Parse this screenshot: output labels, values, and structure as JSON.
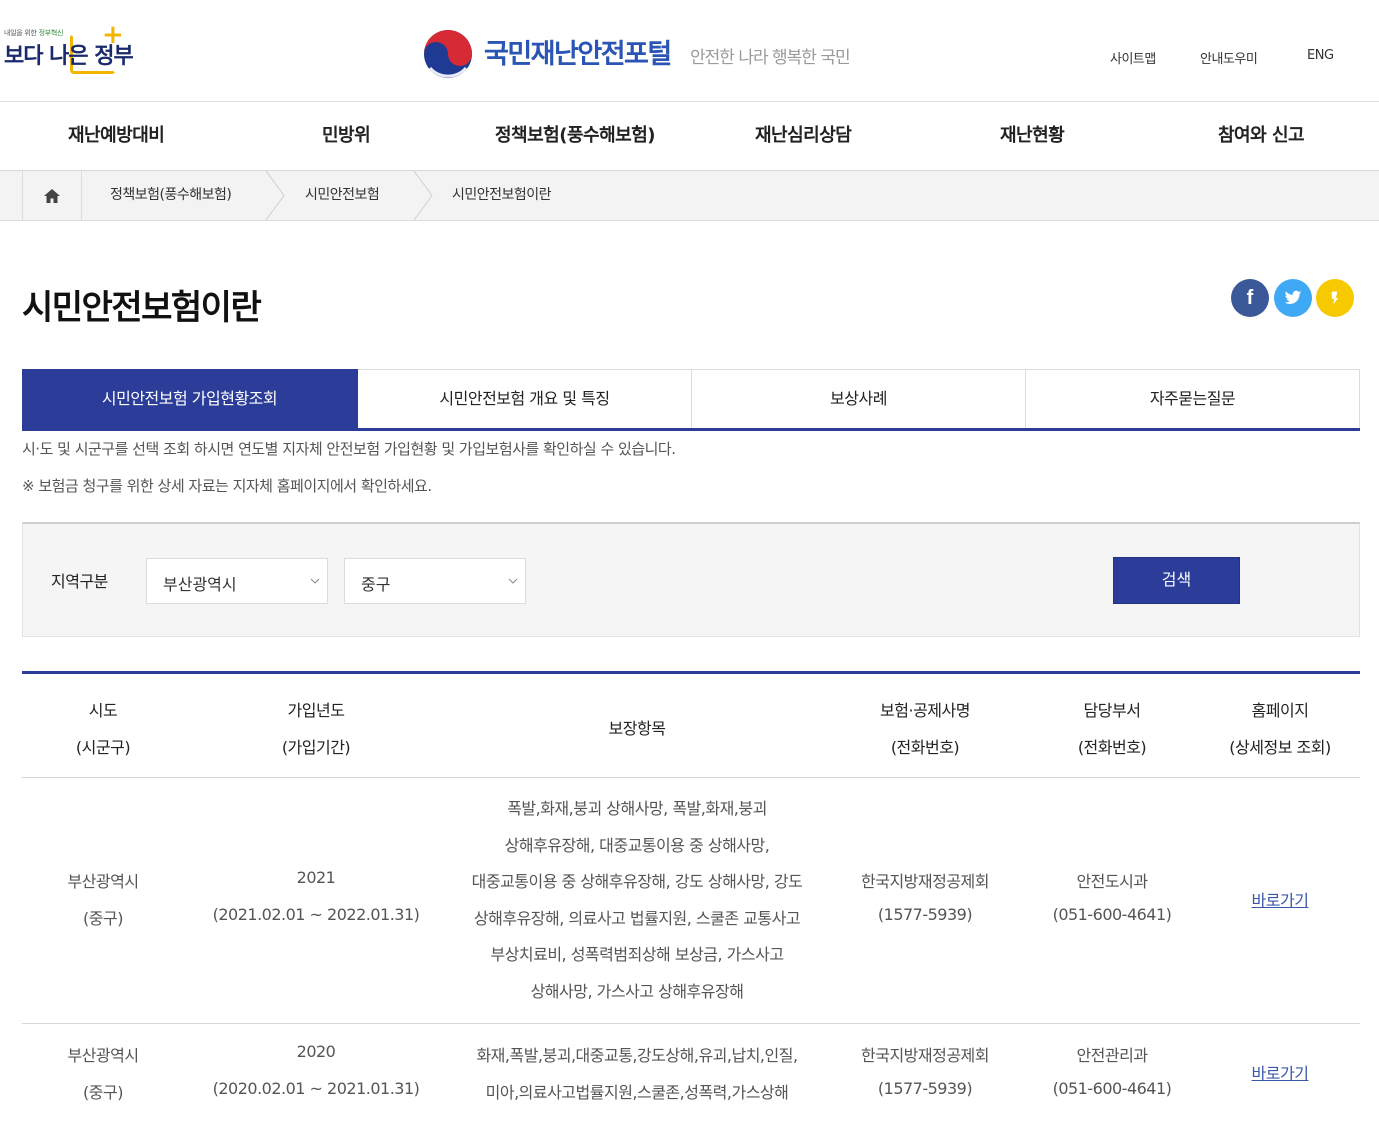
{
  "header": {
    "gov_logo_small_prefix": "내일을 위한 ",
    "gov_logo_small_highlight": "정부혁신",
    "gov_logo_main": "보다 나은 정부",
    "portal_title": "국민재난안전포털",
    "portal_slogan": "안전한 나라 행복한 국민",
    "util_links": [
      "사이트맵",
      "안내도우미",
      "ENG"
    ]
  },
  "gnb": [
    "재난예방대비",
    "민방위",
    "정책보험(풍수해보험)",
    "재난심리상담",
    "재난현황",
    "참여와 신고"
  ],
  "breadcrumb": [
    "정책보험(풍수해보험)",
    "시민안전보험",
    "시민안전보험이란"
  ],
  "page_title": "시민안전보험이란",
  "sns": {
    "facebook_label": "f",
    "colors": {
      "facebook": "#3b5998",
      "twitter": "#3fa9f5",
      "kakao": "#f7c900"
    }
  },
  "tabs": [
    "시민안전보험 가입현황조회",
    "시민안전보험 개요 및 특징",
    "보상사례",
    "자주묻는질문"
  ],
  "description": [
    "시·도 및 시군구를 선택 조회 하시면 연도별 지자체 안전보험 가입현황 및 가입보험사를 확인하실 수 있습니다.",
    "※ 보험금 청구를 위한 상세 자료는 지자체 홈페이지에서 확인하세요."
  ],
  "search": {
    "label": "지역구분",
    "sido": "부산광역시",
    "sigungu": "중구",
    "button": "검색"
  },
  "table": {
    "headers": {
      "sido": [
        "시도",
        "(시군구)"
      ],
      "year": [
        "가입년도",
        "(가입기간)"
      ],
      "coverage": "보장항목",
      "insurer": [
        "보험·공제사명",
        "(전화번호)"
      ],
      "dept": [
        "담당부서",
        "(전화번호)"
      ],
      "homepage": [
        "홈페이지",
        "(상세정보 조회)"
      ]
    },
    "rows": [
      {
        "sido": [
          "부산광역시",
          "(중구)"
        ],
        "year": [
          "2021",
          "(2021.02.01 ~ 2022.01.31)"
        ],
        "coverage": [
          "폭발,화재,붕괴 상해사망, 폭발,화재,붕괴",
          "상해후유장해, 대중교통이용 중 상해사망,",
          "대중교통이용 중 상해후유장해, 강도 상해사망, 강도",
          "상해후유장해, 의료사고 법률지원, 스쿨존 교통사고",
          "부상치료비, 성폭력범죄상해 보상금, 가스사고",
          "상해사망, 가스사고 상해후유장해"
        ],
        "insurer": [
          "한국지방재정공제회",
          "(1577-5939)"
        ],
        "dept": [
          "안전도시과",
          "(051-600-4641)"
        ],
        "link": "바로가기"
      },
      {
        "sido": [
          "부산광역시",
          "(중구)"
        ],
        "year": [
          "2020",
          "(2020.02.01 ~ 2021.01.31)"
        ],
        "coverage": [
          "화재,폭발,붕괴,대중교통,강도상해,유괴,납치,인질,",
          "미아,의료사고법률지원,스쿨존,성폭력,가스상해"
        ],
        "insurer": [
          "한국지방재정공제회",
          "(1577-5939)"
        ],
        "dept": [
          "안전관리과",
          "(051-600-4641)"
        ],
        "link": "바로가기"
      }
    ]
  }
}
